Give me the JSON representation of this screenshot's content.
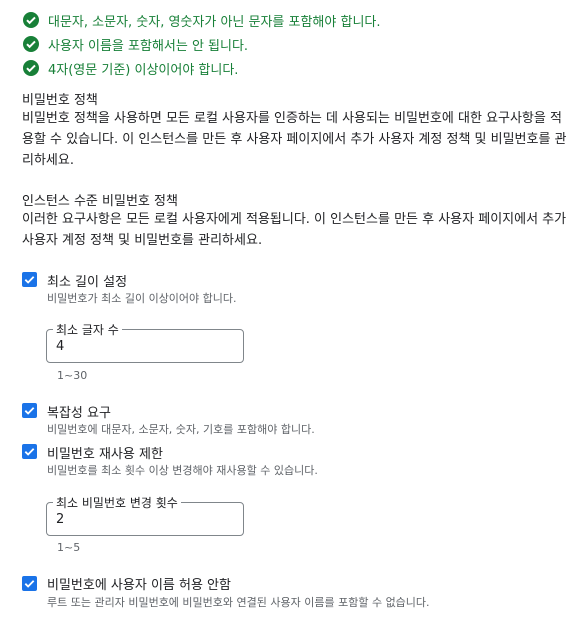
{
  "requirements": [
    {
      "text": "대문자, 소문자, 숫자, 영숫자가 아닌 문자를 포함해야 합니다.",
      "icon": "check-circle-icon"
    },
    {
      "text": "사용자 이름을 포함해서는 안 됩니다.",
      "icon": "check-circle-icon"
    },
    {
      "text": "4자(영문 기준) 이상이어야 합니다.",
      "icon": "check-circle-icon"
    }
  ],
  "password_policy": {
    "title": "비밀번호 정책",
    "description": "비밀번호 정책을 사용하면 모든 로컬 사용자를 인증하는 데 사용되는 비밀번호에 대한 요구사항을 적용할 수 있습니다. 이 인스턴스를 만든 후 사용자 페이지에서 추가 사용자 계정 정책 및 비밀번호를 관리하세요."
  },
  "instance_policy": {
    "title": "인스턴스 수준 비밀번호 정책",
    "description": "이러한 요구사항은 모든 로컬 사용자에게 적용됩니다. 이 인스턴스를 만든 후 사용자 페이지에서 추가 사용자 계정 정책 및 비밀번호를 관리하세요."
  },
  "options": {
    "min_length": {
      "label": "최소 길이 설정",
      "description": "비밀번호가 최소 길이 이상이어야 합니다.",
      "checked": true,
      "field_label": "최소 글자 수",
      "value": "4",
      "hint": "1~30"
    },
    "complexity": {
      "label": "복잡성 요구",
      "description": "비밀번호에 대문자, 소문자, 숫자, 기호를 포함해야 합니다.",
      "checked": true
    },
    "reuse": {
      "label": "비밀번호 재사용 제한",
      "description": "비밀번호를 최소 횟수 이상 변경해야 재사용할 수 있습니다.",
      "checked": true,
      "field_label": "최소 비밀번호 변경 횟수",
      "value": "2",
      "hint": "1~5"
    },
    "disallow_username": {
      "label": "비밀번호에 사용자 이름 허용 안함",
      "description": "루트 또는 관리자 비밀번호에 비밀번호와 연결된 사용자 이름를 포함할 수 없습니다.",
      "checked": true
    }
  },
  "colors": {
    "accent": "#1a73e8",
    "success": "#188038",
    "border": "#80868b",
    "secondary_text": "#5f6368"
  }
}
